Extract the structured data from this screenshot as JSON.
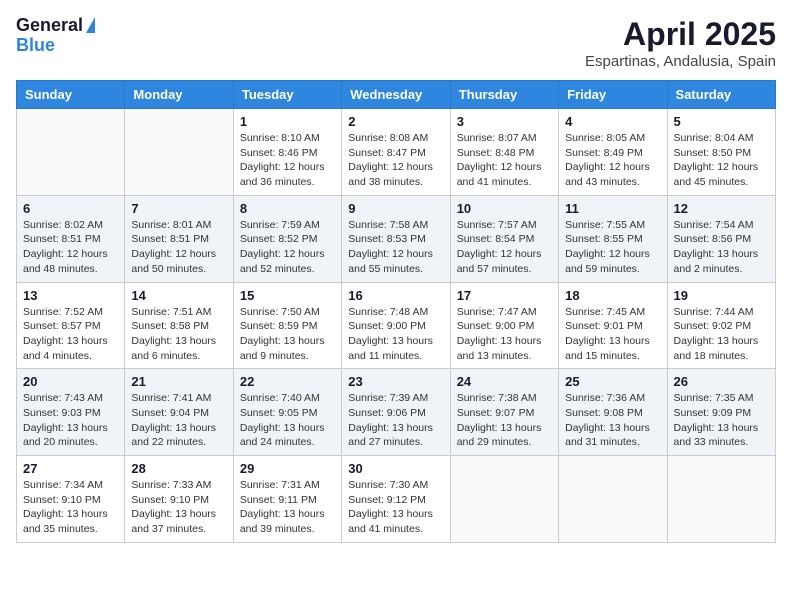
{
  "header": {
    "logo_general": "General",
    "logo_blue": "Blue",
    "month_year": "April 2025",
    "location": "Espartinas, Andalusia, Spain"
  },
  "columns": [
    "Sunday",
    "Monday",
    "Tuesday",
    "Wednesday",
    "Thursday",
    "Friday",
    "Saturday"
  ],
  "weeks": [
    [
      {
        "day": "",
        "info": ""
      },
      {
        "day": "",
        "info": ""
      },
      {
        "day": "1",
        "info": "Sunrise: 8:10 AM\nSunset: 8:46 PM\nDaylight: 12 hours and 36 minutes."
      },
      {
        "day": "2",
        "info": "Sunrise: 8:08 AM\nSunset: 8:47 PM\nDaylight: 12 hours and 38 minutes."
      },
      {
        "day": "3",
        "info": "Sunrise: 8:07 AM\nSunset: 8:48 PM\nDaylight: 12 hours and 41 minutes."
      },
      {
        "day": "4",
        "info": "Sunrise: 8:05 AM\nSunset: 8:49 PM\nDaylight: 12 hours and 43 minutes."
      },
      {
        "day": "5",
        "info": "Sunrise: 8:04 AM\nSunset: 8:50 PM\nDaylight: 12 hours and 45 minutes."
      }
    ],
    [
      {
        "day": "6",
        "info": "Sunrise: 8:02 AM\nSunset: 8:51 PM\nDaylight: 12 hours and 48 minutes."
      },
      {
        "day": "7",
        "info": "Sunrise: 8:01 AM\nSunset: 8:51 PM\nDaylight: 12 hours and 50 minutes."
      },
      {
        "day": "8",
        "info": "Sunrise: 7:59 AM\nSunset: 8:52 PM\nDaylight: 12 hours and 52 minutes."
      },
      {
        "day": "9",
        "info": "Sunrise: 7:58 AM\nSunset: 8:53 PM\nDaylight: 12 hours and 55 minutes."
      },
      {
        "day": "10",
        "info": "Sunrise: 7:57 AM\nSunset: 8:54 PM\nDaylight: 12 hours and 57 minutes."
      },
      {
        "day": "11",
        "info": "Sunrise: 7:55 AM\nSunset: 8:55 PM\nDaylight: 12 hours and 59 minutes."
      },
      {
        "day": "12",
        "info": "Sunrise: 7:54 AM\nSunset: 8:56 PM\nDaylight: 13 hours and 2 minutes."
      }
    ],
    [
      {
        "day": "13",
        "info": "Sunrise: 7:52 AM\nSunset: 8:57 PM\nDaylight: 13 hours and 4 minutes."
      },
      {
        "day": "14",
        "info": "Sunrise: 7:51 AM\nSunset: 8:58 PM\nDaylight: 13 hours and 6 minutes."
      },
      {
        "day": "15",
        "info": "Sunrise: 7:50 AM\nSunset: 8:59 PM\nDaylight: 13 hours and 9 minutes."
      },
      {
        "day": "16",
        "info": "Sunrise: 7:48 AM\nSunset: 9:00 PM\nDaylight: 13 hours and 11 minutes."
      },
      {
        "day": "17",
        "info": "Sunrise: 7:47 AM\nSunset: 9:00 PM\nDaylight: 13 hours and 13 minutes."
      },
      {
        "day": "18",
        "info": "Sunrise: 7:45 AM\nSunset: 9:01 PM\nDaylight: 13 hours and 15 minutes."
      },
      {
        "day": "19",
        "info": "Sunrise: 7:44 AM\nSunset: 9:02 PM\nDaylight: 13 hours and 18 minutes."
      }
    ],
    [
      {
        "day": "20",
        "info": "Sunrise: 7:43 AM\nSunset: 9:03 PM\nDaylight: 13 hours and 20 minutes."
      },
      {
        "day": "21",
        "info": "Sunrise: 7:41 AM\nSunset: 9:04 PM\nDaylight: 13 hours and 22 minutes."
      },
      {
        "day": "22",
        "info": "Sunrise: 7:40 AM\nSunset: 9:05 PM\nDaylight: 13 hours and 24 minutes."
      },
      {
        "day": "23",
        "info": "Sunrise: 7:39 AM\nSunset: 9:06 PM\nDaylight: 13 hours and 27 minutes."
      },
      {
        "day": "24",
        "info": "Sunrise: 7:38 AM\nSunset: 9:07 PM\nDaylight: 13 hours and 29 minutes."
      },
      {
        "day": "25",
        "info": "Sunrise: 7:36 AM\nSunset: 9:08 PM\nDaylight: 13 hours and 31 minutes."
      },
      {
        "day": "26",
        "info": "Sunrise: 7:35 AM\nSunset: 9:09 PM\nDaylight: 13 hours and 33 minutes."
      }
    ],
    [
      {
        "day": "27",
        "info": "Sunrise: 7:34 AM\nSunset: 9:10 PM\nDaylight: 13 hours and 35 minutes."
      },
      {
        "day": "28",
        "info": "Sunrise: 7:33 AM\nSunset: 9:10 PM\nDaylight: 13 hours and 37 minutes."
      },
      {
        "day": "29",
        "info": "Sunrise: 7:31 AM\nSunset: 9:11 PM\nDaylight: 13 hours and 39 minutes."
      },
      {
        "day": "30",
        "info": "Sunrise: 7:30 AM\nSunset: 9:12 PM\nDaylight: 13 hours and 41 minutes."
      },
      {
        "day": "",
        "info": ""
      },
      {
        "day": "",
        "info": ""
      },
      {
        "day": "",
        "info": ""
      }
    ]
  ]
}
